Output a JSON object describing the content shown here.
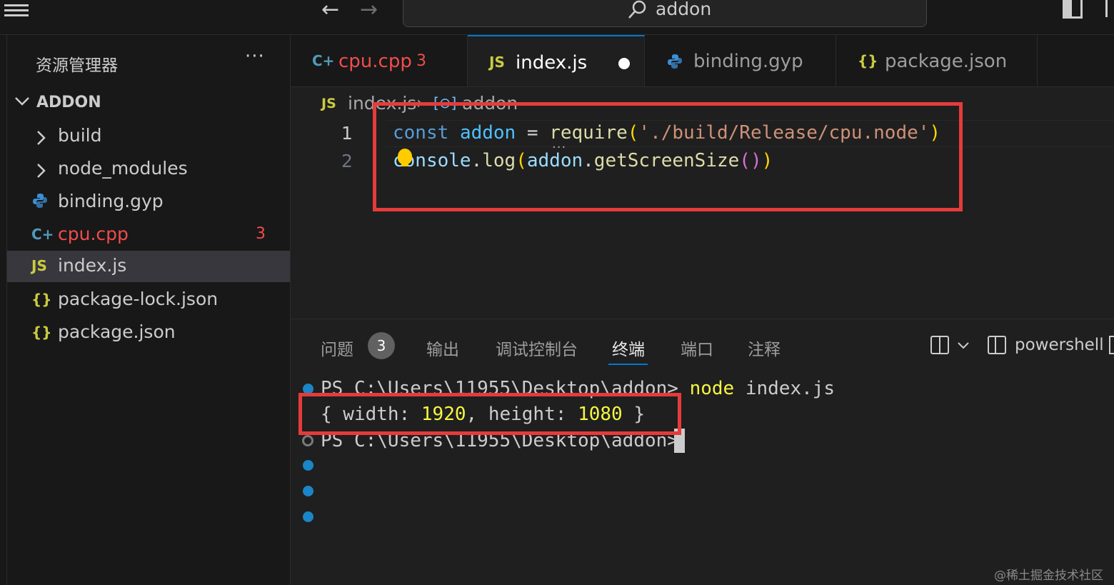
{
  "titlebar": {
    "search_text": "addon"
  },
  "sidebar": {
    "title": "资源管理器",
    "more": "···",
    "root": "ADDON",
    "items": [
      {
        "label": "build",
        "kind": "folder"
      },
      {
        "label": "node_modules",
        "kind": "folder"
      },
      {
        "label": "binding.gyp",
        "kind": "python-file",
        "icon": "python-icon"
      },
      {
        "label": "cpu.cpp",
        "kind": "cpp-file",
        "icon": "cpp-icon",
        "errors": "3"
      },
      {
        "label": "index.js",
        "kind": "js-file",
        "icon": "js-icon",
        "selected": true
      },
      {
        "label": "package-lock.json",
        "kind": "json-file",
        "icon": "json-icon"
      },
      {
        "label": "package.json",
        "kind": "json-file",
        "icon": "json-icon"
      }
    ]
  },
  "tabs": [
    {
      "label": "cpu.cpp",
      "badge": "3",
      "icon": "cpp-icon"
    },
    {
      "label": "index.js",
      "dirty": true,
      "active": true,
      "icon": "js-icon"
    },
    {
      "label": "binding.gyp",
      "icon": "python-icon"
    },
    {
      "label": "package.json",
      "icon": "json-icon"
    }
  ],
  "icons": {
    "js": "JS",
    "json": "{}",
    "cpp": "C+",
    "python": "Py"
  },
  "breadcrumb": {
    "file": "index.js",
    "sep": "›",
    "symbol_icon": "[⊙]",
    "symbol": "addon"
  },
  "editor": {
    "line_numbers": [
      "1",
      "2"
    ],
    "lines": [
      [
        "const",
        " ",
        "addon",
        " = ",
        "require",
        "(",
        "'./build/Release/cpu.node'",
        ")"
      ],
      [
        "console",
        ".",
        "log",
        "(",
        "addon",
        ".",
        "getScreenSize",
        "()",
        ")"
      ]
    ]
  },
  "panel": {
    "tabs": [
      "问题",
      "输出",
      "调试控制台",
      "终端",
      "端口",
      "注释"
    ],
    "problems_count": "3",
    "active_tab": "终端",
    "shell": "powershell"
  },
  "terminal": {
    "prompt": "PS C:\\Users\\11955\\Desktop\\addon>",
    "command_name": "node",
    "command_args": " index.js",
    "output_open": "{ width: ",
    "width": "1920",
    "output_mid": ", height: ",
    "height": "1080",
    "output_close": " }"
  },
  "watermark": "@稀土掘金技术社区",
  "colors": {
    "accent": "#0078d4",
    "highlight_box": "#e63b3b",
    "error": "#f14c4c"
  }
}
